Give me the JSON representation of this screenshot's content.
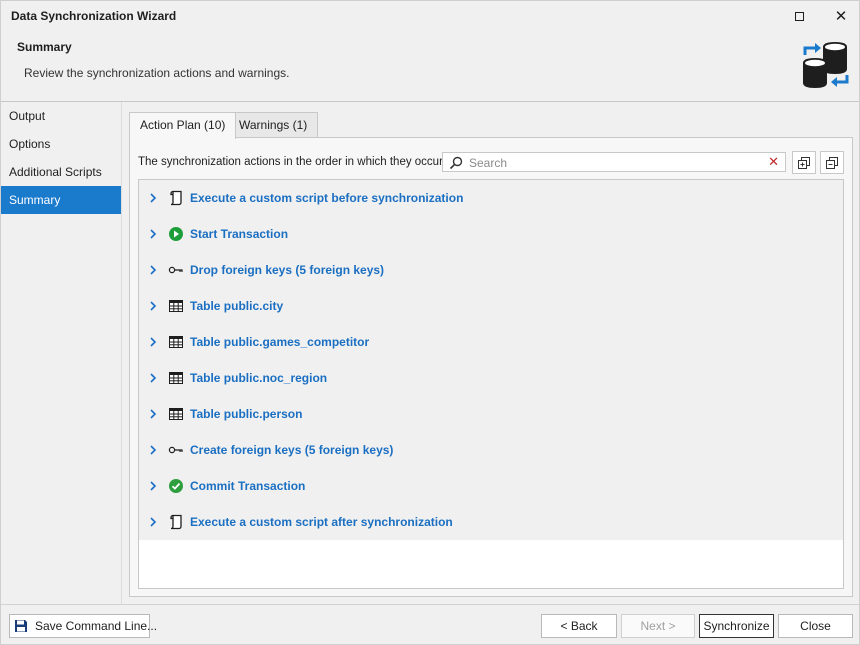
{
  "window": {
    "title": "Data Synchronization Wizard",
    "maximize_label": "",
    "close_label": "✕"
  },
  "header": {
    "title": "Summary",
    "description": "Review the synchronization actions and warnings.",
    "icon": "database-sync-icon"
  },
  "sidebar": {
    "items": [
      {
        "label": "Output",
        "active": false
      },
      {
        "label": "Options",
        "active": false
      },
      {
        "label": "Additional Scripts",
        "active": false
      },
      {
        "label": "Summary",
        "active": true
      }
    ]
  },
  "tabs": [
    {
      "label": "Action Plan (10)",
      "active": true
    },
    {
      "label": "Warnings (1)",
      "active": false
    }
  ],
  "action_plan": {
    "caption": "The synchronization actions in the order in which they occur.",
    "search": {
      "placeholder": "Search",
      "value": "",
      "clear_glyph": "✕"
    },
    "actions": [
      {
        "label": "Execute a custom script before synchronization",
        "icon": "script-icon"
      },
      {
        "label": "Start Transaction",
        "icon": "play-icon"
      },
      {
        "label": "Drop foreign keys (5 foreign keys)",
        "icon": "key-icon"
      },
      {
        "label": "Table public.city",
        "icon": "table-icon"
      },
      {
        "label": "Table public.games_competitor",
        "icon": "table-icon"
      },
      {
        "label": "Table public.noc_region",
        "icon": "table-icon"
      },
      {
        "label": "Table public.person",
        "icon": "table-icon"
      },
      {
        "label": "Create foreign keys (5 foreign keys)",
        "icon": "key-icon"
      },
      {
        "label": "Commit Transaction",
        "icon": "check-icon"
      },
      {
        "label": "Execute a custom script after synchronization",
        "icon": "script-icon"
      }
    ]
  },
  "footer": {
    "save_label": "Save Command Line...",
    "back_label": "< Back",
    "next_label": "Next >",
    "synchronize_label": "Synchronize",
    "close_label": "Close"
  },
  "colors": {
    "accent": "#1a7acc",
    "link": "#1a6fc2",
    "play": "#1e9e3a",
    "check": "#2e9e3f"
  }
}
